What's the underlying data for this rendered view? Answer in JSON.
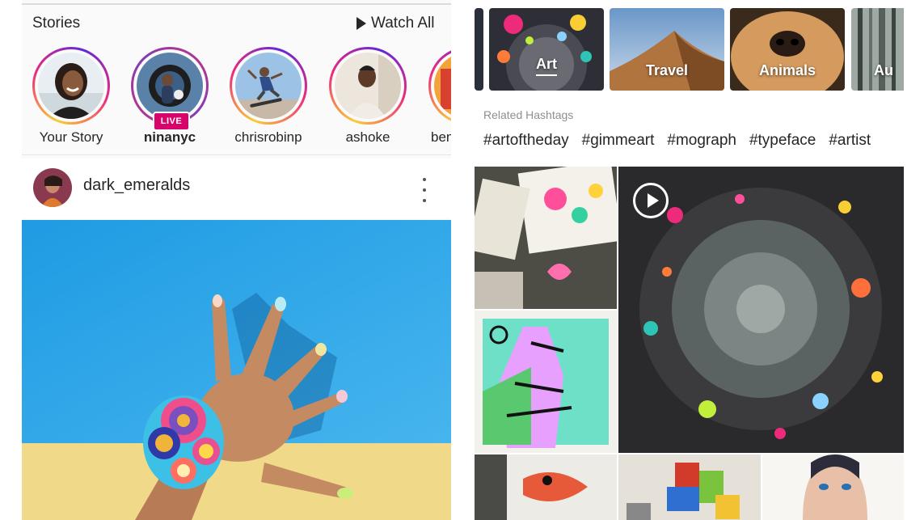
{
  "feed": {
    "stories_title": "Stories",
    "watch_all": "Watch All",
    "stories": [
      {
        "label": "Your Story",
        "live": false
      },
      {
        "label": "ninanyc",
        "live": true,
        "badge": "LIVE"
      },
      {
        "label": "chrisrobinp",
        "live": false
      },
      {
        "label": "ashoke",
        "live": false
      },
      {
        "label": "ben",
        "live": false
      }
    ],
    "post": {
      "username": "dark_emeralds",
      "more_icon": "more-vertical-icon"
    }
  },
  "explore": {
    "topics": [
      {
        "label": "Art",
        "selected": true
      },
      {
        "label": "Travel",
        "selected": false
      },
      {
        "label": "Animals",
        "selected": false
      },
      {
        "label": "Au",
        "selected": false
      }
    ],
    "related_title": "Related Hashtags",
    "hashtags": [
      "#artoftheday",
      "#gimmeart",
      "#mograph",
      "#typeface",
      "#artist"
    ],
    "video_icon": "play-circle-icon"
  },
  "colors": {
    "live_badge": "#d6046b",
    "story_ring_start": "#f9ce34",
    "story_ring_mid": "#ee2a7b",
    "story_ring_end": "#6228d7"
  }
}
